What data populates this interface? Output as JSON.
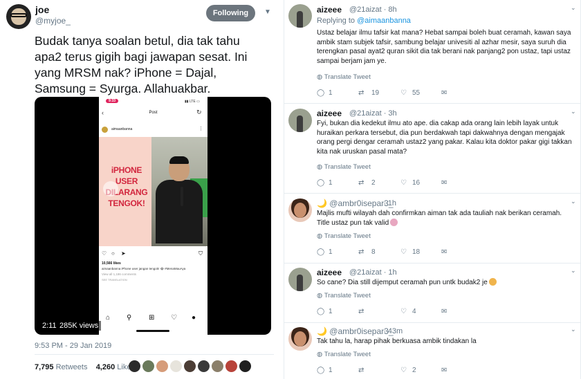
{
  "main_tweet": {
    "author_name": "joe",
    "author_handle": "@myjoe_",
    "follow_label": "Following",
    "text": "Budak tanya soalan betul, dia tak tahu\napa2 terus gigih bagi jawapan sesat. Ini\nyang MRSM nak? iPhone = Dajal,\nSamsung = Syurga. Allahuakbar.",
    "timestamp": "9:53 PM - 29 Jan 2019",
    "retweets_count": "7,795",
    "retweets_label": "Retweets",
    "likes_count": "4,260",
    "likes_label": "Likes",
    "video": {
      "duration": "2:11",
      "views": "285K views",
      "phone_time": "9:33",
      "phone_signal": "▮▮ LTE ▭",
      "post_header": "Post",
      "post_username": "aimaanbanna",
      "overlay_text": "iPHONE USER\nDILARANG\nTENGOK!",
      "likes_line": "10,566 likes",
      "caption_line": "aimaanbanna iPhone user jangan tengok! 😂 #MenaMauAya",
      "comments_line": "View all 1,186 comments",
      "translation_line": "SEE TRANSLATION"
    }
  },
  "replies": [
    {
      "name": "aizeee",
      "handle": "@21aizat · 8h",
      "replying_prefix": "Replying to ",
      "replying_to": "@aimaanbanna",
      "text": "Ustaz belajar ilmu tafsir kat mana? Hebat sampai boleh buat ceramah, kawan saya ambik stam subjek tafsir, sambung belajar univesiti al azhar mesir, saya suruh dia terengkan pasal ayat2 quran sikit dia tak berani nak panjang2 pon ustaz, tapi ustaz sampai berjam jam ye.",
      "translate": "Translate Tweet",
      "replies": "1",
      "retweets": "19",
      "likes": "55"
    },
    {
      "name": "aizeee",
      "handle": "@21aizat · 3h",
      "text": "Fyi, bukan dia kedekut ilmu ato ape. dia cakap ada orang lain lebih layak untuk huraikan perkara tersebut, dia pun berdakwah tapi dakwahnya dengan mengajak orang pergi dengar ceramah ustaz2 yang pakar. Kalau kita doktor pakar gigi takkan kita nak uruskan pasal mata?",
      "translate": "Translate Tweet",
      "replies": "1",
      "retweets": "2",
      "likes": "16"
    },
    {
      "name": "🌙 @ambr0isepar3_",
      "handle": "· 1h",
      "text": "Majlis mufti wilayah dah confirmkan aiman tak ada tauliah nak berikan ceramah. Title ustaz pun tak valid",
      "translate": "Translate Tweet",
      "replies": "1",
      "retweets": "8",
      "likes": "18"
    },
    {
      "name": "aizeee",
      "handle": "@21aizat · 1h",
      "text": "So cane? Dia still dijemput ceramah pun untk budak2 je",
      "translate": "Translate Tweet",
      "replies": "1",
      "retweets": "",
      "likes": "4"
    },
    {
      "name": "🌙 @ambr0isepar3_",
      "handle": "· 43m",
      "text": "Tak tahu la, harap pihak berkuasa ambik tindakan la",
      "translate": "Translate Tweet",
      "replies": "1",
      "retweets": "",
      "likes": "2"
    }
  ],
  "icons": {
    "reply": "💬",
    "retweet": "⇄",
    "like": "♡",
    "dm": "✉",
    "globe": "🌐",
    "chevron": "⌄"
  },
  "colors": {
    "link": "#1b95e0",
    "muted": "#657786",
    "follow_bg": "#6c757d",
    "overlay_red": "#d2263e"
  }
}
